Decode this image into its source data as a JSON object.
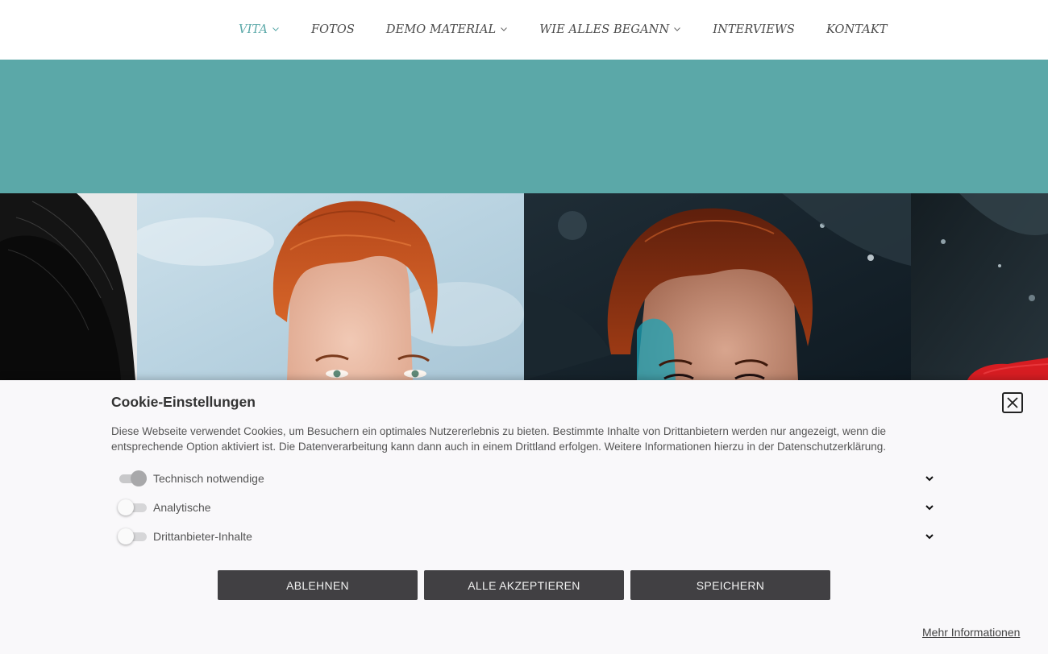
{
  "nav": {
    "items": [
      {
        "label": "VITA",
        "active": true,
        "has_dropdown": true
      },
      {
        "label": "FOTOS",
        "active": false,
        "has_dropdown": false
      },
      {
        "label": "DEMO MATERIAL",
        "active": false,
        "has_dropdown": true
      },
      {
        "label": "WIE ALLES BEGANN",
        "active": false,
        "has_dropdown": true
      },
      {
        "label": "INTERVIEWS",
        "active": false,
        "has_dropdown": false
      },
      {
        "label": "KONTAKT",
        "active": false,
        "has_dropdown": false
      }
    ],
    "active_color": "#5aa8a8",
    "text_color": "#4a4a4a"
  },
  "banner": {
    "color": "#5ba8a8"
  },
  "gallery": {
    "photos": [
      {
        "name": "black-white-portrait"
      },
      {
        "name": "portrait-light-background"
      },
      {
        "name": "portrait-dark-background"
      },
      {
        "name": "portrait-red-clothing"
      }
    ]
  },
  "cookie": {
    "title": "Cookie-Einstellungen",
    "text": "Diese Webseite verwendet Cookies, um Besuchern ein optimales Nutzererlebnis zu bieten. Bestimmte Inhalte von Drittanbietern werden nur angezeigt, wenn die entsprechende Option aktiviert ist. Die Datenverarbeitung kann dann auch in einem Drittland erfolgen. Weitere Informationen hierzu in der Datenschutzerklärung.",
    "options": [
      {
        "label": "Technisch notwendige",
        "enabled": true,
        "locked": true
      },
      {
        "label": "Analytische",
        "enabled": false,
        "locked": false
      },
      {
        "label": "Drittanbieter-Inhalte",
        "enabled": false,
        "locked": false
      }
    ],
    "buttons": {
      "reject": "ABLEHNEN",
      "accept_all": "ALLE AKZEPTIEREN",
      "save": "SPEICHERN"
    },
    "more_info": "Mehr Informationen",
    "close_icon": "close-icon",
    "button_color": "#414043"
  }
}
